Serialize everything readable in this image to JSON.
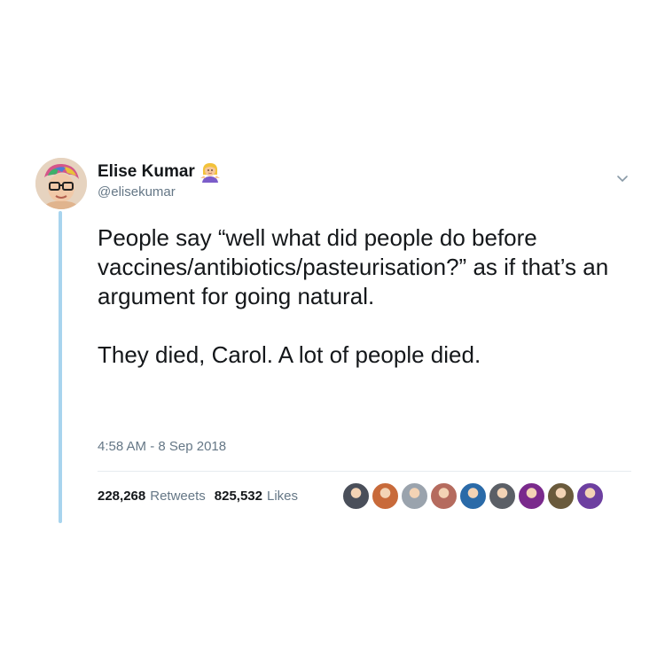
{
  "tweet": {
    "display_name": "Elise Kumar",
    "handle": "@elisekumar",
    "text": "People say “well what did people do before vaccines/antibiotics/pasteurisation?” as if that’s an argument for going natural.\n\nThey died, Carol. A lot of people died.",
    "timestamp": "4:58 AM - 8 Sep 2018",
    "retweets_count": "228,268",
    "retweets_label": "Retweets",
    "likes_count": "825,532",
    "likes_label": "Likes"
  },
  "icons": {
    "name_emoji": "woman-shrugging-icon",
    "menu": "chevron-down-icon"
  },
  "colors": {
    "thread_line": "#a8d4ee",
    "secondary_text": "#657786",
    "primary_text": "#14171a"
  },
  "liker_avatar_colors": [
    "#4a4f5a",
    "#c86a3a",
    "#9aa3ad",
    "#b56b5e",
    "#2a6aa8",
    "#5b5f66",
    "#7a2a8c",
    "#6a5a3c",
    "#6d3fa0"
  ]
}
